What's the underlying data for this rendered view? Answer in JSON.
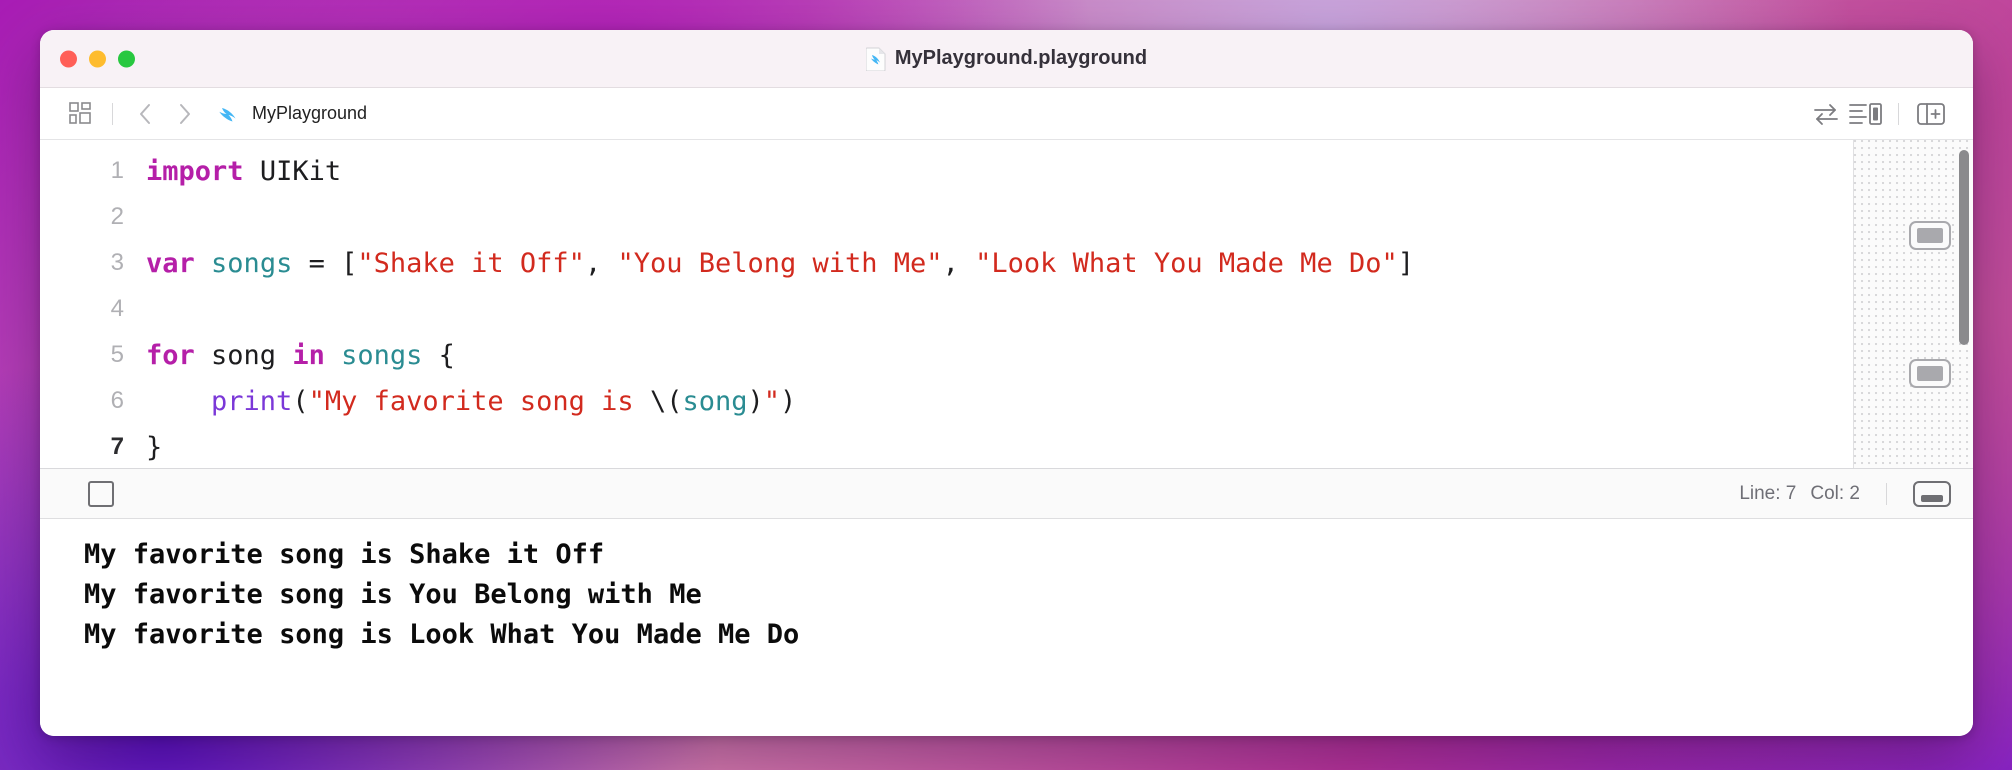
{
  "window": {
    "title": "MyPlayground.playground",
    "traffic_lights": [
      {
        "name": "close",
        "color": "#ff5f57"
      },
      {
        "name": "minimize",
        "color": "#febc2e"
      },
      {
        "name": "maximize",
        "color": "#28c840"
      }
    ]
  },
  "toolbar": {
    "left_icons": [
      "grid-icon",
      "back-chevron-icon",
      "forward-chevron-icon"
    ],
    "breadcrumb": "MyPlayground",
    "breadcrumb_icon": "swift-bird-icon",
    "right_icons": [
      "swap-arrows-icon",
      "text-and-panel-icon",
      "add-panel-icon"
    ]
  },
  "editor": {
    "lines": [
      {
        "number": "1",
        "current": false,
        "tokens": [
          {
            "text": "import",
            "kind": "kw"
          },
          {
            "text": " ",
            "kind": "plain"
          },
          {
            "text": "UIKit",
            "kind": "type"
          }
        ]
      },
      {
        "number": "2",
        "current": false,
        "tokens": []
      },
      {
        "number": "3",
        "current": false,
        "tokens": [
          {
            "text": "var",
            "kind": "kw"
          },
          {
            "text": " ",
            "kind": "plain"
          },
          {
            "text": "songs",
            "kind": "var"
          },
          {
            "text": " = [",
            "kind": "plain"
          },
          {
            "text": "\"Shake it Off\"",
            "kind": "str"
          },
          {
            "text": ", ",
            "kind": "plain"
          },
          {
            "text": "\"You Belong with Me\"",
            "kind": "str"
          },
          {
            "text": ", ",
            "kind": "plain"
          },
          {
            "text": "\"Look What You Made Me Do\"",
            "kind": "str"
          },
          {
            "text": "]",
            "kind": "plain"
          }
        ]
      },
      {
        "number": "4",
        "current": false,
        "tokens": []
      },
      {
        "number": "5",
        "current": false,
        "tokens": [
          {
            "text": "for",
            "kind": "kw"
          },
          {
            "text": " song ",
            "kind": "plain"
          },
          {
            "text": "in",
            "kind": "kw"
          },
          {
            "text": " ",
            "kind": "plain"
          },
          {
            "text": "songs",
            "kind": "var"
          },
          {
            "text": " {",
            "kind": "plain"
          }
        ]
      },
      {
        "number": "6",
        "current": false,
        "tokens": [
          {
            "text": "    ",
            "kind": "plain"
          },
          {
            "text": "print",
            "kind": "fn"
          },
          {
            "text": "(",
            "kind": "plain"
          },
          {
            "text": "\"My favorite song is ",
            "kind": "str"
          },
          {
            "text": "\\(",
            "kind": "plain"
          },
          {
            "text": "song",
            "kind": "var"
          },
          {
            "text": ")",
            "kind": "plain"
          },
          {
            "text": "\"",
            "kind": "str"
          },
          {
            "text": ")",
            "kind": "plain"
          }
        ]
      },
      {
        "number": "7",
        "current": true,
        "tokens": [
          {
            "text": "}",
            "kind": "plain"
          }
        ]
      }
    ],
    "results_sidebar": {
      "quick_look_buttons": [
        "quick-look-line-3",
        "quick-look-line-6"
      ]
    }
  },
  "statusbar": {
    "stop_button_label": "stop-button",
    "line_label": "Line: 7",
    "col_label": "Col: 2",
    "console_toggle_label": "console-toggle"
  },
  "console": {
    "lines": [
      "My favorite song is Shake it Off",
      "My favorite song is You Belong with Me",
      "My favorite song is Look What You Made Me Do"
    ]
  },
  "colors": {
    "keyword": "#b51fa8",
    "string": "#d22a1e",
    "variable": "#2a8c92",
    "function": "#7b38d8",
    "plain": "#1d1d1f",
    "titlebar_bg": "#f8f2f6",
    "swift_blue": "#44b7f5"
  }
}
